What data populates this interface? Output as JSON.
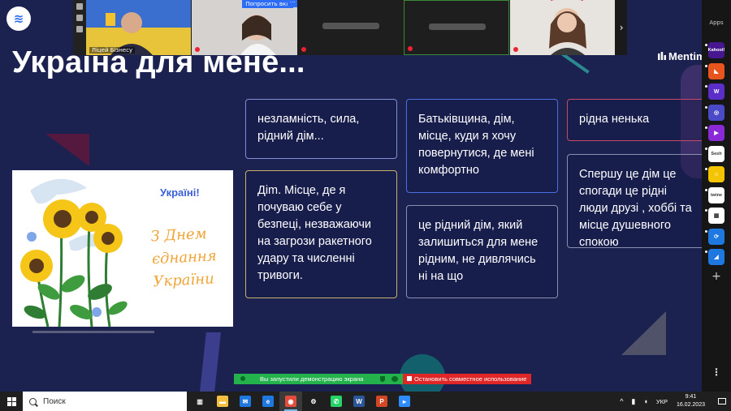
{
  "slide": {
    "title": "Україна для мене...",
    "brand": "Mentim",
    "poster": {
      "heading": "Україні!",
      "greeting": "З Днем єднання України"
    }
  },
  "answers": [
    {
      "text": "незламність, сила, рідний дім...",
      "border": "#7f8fd8"
    },
    {
      "text": "Діm. Місце, де я почуваю себе у безпеці, незважаючи на загрози ракетного удару та численні тривоги.",
      "border": "#c9b06a"
    },
    {
      "text": "Батьківщина, дім, місце, куди я хочу повернутися, де мені комфортно",
      "border": "#4a6fe0"
    },
    {
      "text": "це рідний дім, який залишиться для мене рідним, не дивлячись ні на що",
      "border": "#8a8fb0"
    },
    {
      "text": "рідна ненька",
      "border": "#c84a6a"
    },
    {
      "text": "Спершу це дім це спогади це рідні люди друзі , хоббі та місце душевного спокою",
      "border": "#8a8fb0"
    }
  ],
  "video": {
    "tile1_label": "Ліцей Бізнесу",
    "raise_hand": "Попросить вкл",
    "more": "···",
    "next": "›"
  },
  "apps": {
    "title": "Apps",
    "items": [
      {
        "label": "Kahoot!",
        "bg": "#46178f",
        "icon": "kahoot-icon"
      },
      {
        "label": "◣",
        "bg": "#e8541e",
        "icon": "flag-app-icon"
      },
      {
        "label": "W",
        "bg": "#5c2ec9",
        "icon": "wordwall-icon"
      },
      {
        "label": "◎",
        "bg": "#4a4ac8",
        "icon": "target-app-icon"
      },
      {
        "label": "▶",
        "bg": "#8a2ad6",
        "icon": "play-app-icon"
      },
      {
        "label": "Sesh",
        "bg": "#ffffff",
        "icon": "sesh-icon"
      },
      {
        "label": "☺",
        "bg": "#f5c400",
        "icon": "smile-app-icon"
      },
      {
        "label": "twine",
        "bg": "#ffffff",
        "icon": "twine-icon"
      },
      {
        "label": "▦",
        "bg": "#ffffff",
        "icon": "grid-app-icon"
      },
      {
        "label": "⟳",
        "bg": "#1e78e0",
        "icon": "sync-app-icon"
      },
      {
        "label": "◢",
        "bg": "#1e78e0",
        "icon": "blue-app-icon"
      }
    ],
    "add": "+",
    "menu": "⋮"
  },
  "share": {
    "status": "Вы запустили демонстрацию экрана",
    "stop": "Остановить совместное использование"
  },
  "taskbar": {
    "search_placeholder": "Поиск",
    "lang": "УКР",
    "time": "9:41",
    "date": "16.02.2023",
    "apps": [
      {
        "name": "task-view-icon",
        "glyph": "▥",
        "bg": "transparent"
      },
      {
        "name": "file-explorer-icon",
        "glyph": "▬",
        "bg": "#f3c042"
      },
      {
        "name": "mail-icon",
        "glyph": "✉",
        "bg": "#1e78e0"
      },
      {
        "name": "edge-icon",
        "glyph": "e",
        "bg": "#1e78e0"
      },
      {
        "name": "chrome-icon",
        "glyph": "◉",
        "bg": "#e24c3c"
      },
      {
        "name": "settings-icon",
        "glyph": "⚙",
        "bg": "transparent"
      },
      {
        "name": "whatsapp-icon",
        "glyph": "✆",
        "bg": "#25d366"
      },
      {
        "name": "word-icon",
        "glyph": "W",
        "bg": "#2b579a"
      },
      {
        "name": "powerpoint-icon",
        "glyph": "P",
        "bg": "#d24726"
      },
      {
        "name": "zoom-icon",
        "glyph": "▸",
        "bg": "#2d8cff"
      }
    ]
  }
}
